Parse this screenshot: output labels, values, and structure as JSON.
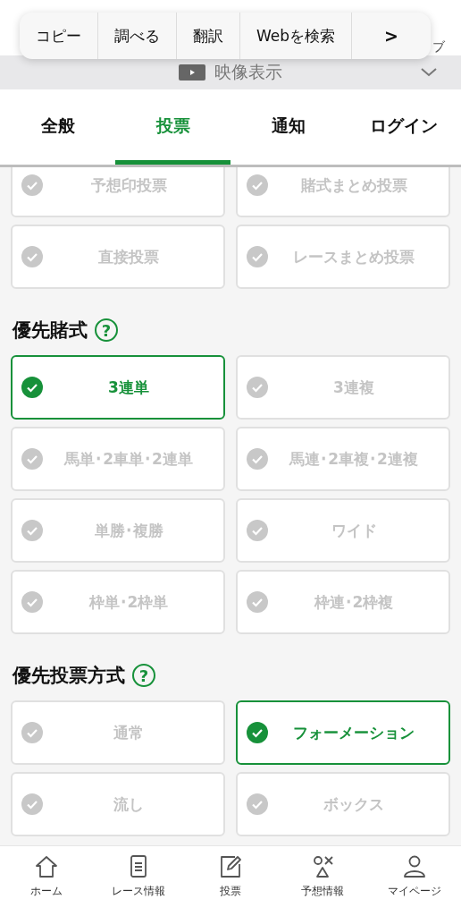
{
  "popup_menu": {
    "items": [
      "コピー",
      "調べる",
      "翻訳",
      "Webを検索"
    ],
    "more": ">"
  },
  "header": {
    "fragment": "ブ"
  },
  "video_bar": {
    "label": "映像表示",
    "expanded": false
  },
  "tabs": [
    {
      "label": "全般",
      "selected": false
    },
    {
      "label": "投票",
      "selected": true
    },
    {
      "label": "通知",
      "selected": false
    },
    {
      "label": "ログイン",
      "selected": false
    }
  ],
  "sections": [
    {
      "options": [
        {
          "label": "予想印投票",
          "selected": false
        },
        {
          "label": "賭式まとめ投票",
          "selected": false
        },
        {
          "label": "直接投票",
          "selected": false
        },
        {
          "label": "レースまとめ投票",
          "selected": false
        }
      ]
    },
    {
      "title": "優先賭式",
      "help": "?",
      "options": [
        {
          "label": "3連単",
          "selected": true
        },
        {
          "label": "3連複",
          "selected": false
        },
        {
          "label": "馬単･2車単･2連単",
          "selected": false
        },
        {
          "label": "馬連･2車複･2連複",
          "selected": false
        },
        {
          "label": "単勝･複勝",
          "selected": false
        },
        {
          "label": "ワイド",
          "selected": false
        },
        {
          "label": "枠単･2枠単",
          "selected": false
        },
        {
          "label": "枠連･2枠複",
          "selected": false
        }
      ]
    },
    {
      "title": "優先投票方式",
      "help": "?",
      "options": [
        {
          "label": "通常",
          "selected": false
        },
        {
          "label": "フォーメーション",
          "selected": true
        },
        {
          "label": "流し",
          "selected": false
        },
        {
          "label": "ボックス",
          "selected": false
        }
      ]
    }
  ],
  "bottom_nav": [
    {
      "kind": "home",
      "label": "ホーム"
    },
    {
      "kind": "list",
      "label": "レース情報"
    },
    {
      "kind": "edit",
      "label": "投票"
    },
    {
      "kind": "marks",
      "label": "予想情報"
    },
    {
      "kind": "user",
      "label": "マイページ"
    }
  ]
}
